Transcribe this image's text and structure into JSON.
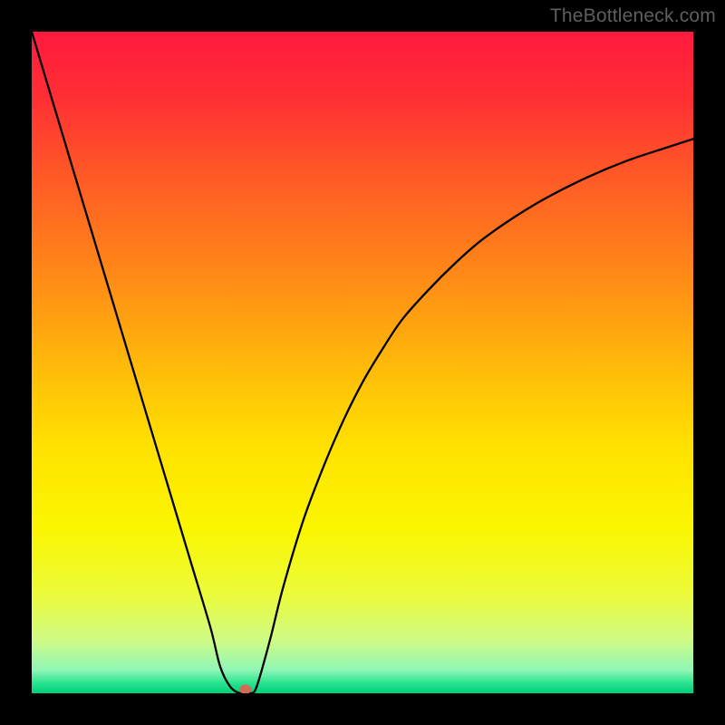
{
  "attribution": "TheBottleneck.com",
  "chart_data": {
    "type": "line",
    "title": "",
    "xlabel": "",
    "ylabel": "",
    "xlim": [
      0,
      100
    ],
    "ylim": [
      0,
      100
    ],
    "grid": false,
    "legend": false,
    "background_gradient_stops": [
      {
        "offset": 0.0,
        "color": "#ff1a3e"
      },
      {
        "offset": 0.1,
        "color": "#ff2f34"
      },
      {
        "offset": 0.22,
        "color": "#ff5a26"
      },
      {
        "offset": 0.35,
        "color": "#ff8319"
      },
      {
        "offset": 0.5,
        "color": "#ffb80a"
      },
      {
        "offset": 0.63,
        "color": "#ffe200"
      },
      {
        "offset": 0.75,
        "color": "#faf600"
      },
      {
        "offset": 0.85,
        "color": "#ecfb3a"
      },
      {
        "offset": 0.92,
        "color": "#cffb85"
      },
      {
        "offset": 0.965,
        "color": "#8ff6b6"
      },
      {
        "offset": 0.985,
        "color": "#27e38e"
      },
      {
        "offset": 1.0,
        "color": "#00cf7a"
      }
    ],
    "series": [
      {
        "name": "bottleneck-curve",
        "color": "#000000",
        "stroke_width": 2.3,
        "x": [
          0,
          3,
          6,
          9,
          12,
          15,
          18,
          21,
          24,
          27,
          28.5,
          30,
          31.5,
          33,
          34,
          36,
          38,
          41,
          44,
          47,
          50,
          53,
          56,
          60,
          64,
          68,
          73,
          78,
          84,
          90,
          96,
          100
        ],
        "values": [
          100,
          90,
          80,
          70,
          60,
          50,
          40,
          30,
          20,
          10,
          4,
          1,
          0,
          0,
          1,
          8,
          16,
          26,
          34,
          41,
          47,
          52,
          56.5,
          61,
          65,
          68.5,
          72,
          75,
          78,
          80.5,
          82.5,
          83.8
        ]
      }
    ],
    "marker": {
      "name": "optimal-point",
      "x": 32.3,
      "y": 0.6,
      "rx": 6.5,
      "ry": 5.3,
      "color": "#d46a55"
    }
  }
}
